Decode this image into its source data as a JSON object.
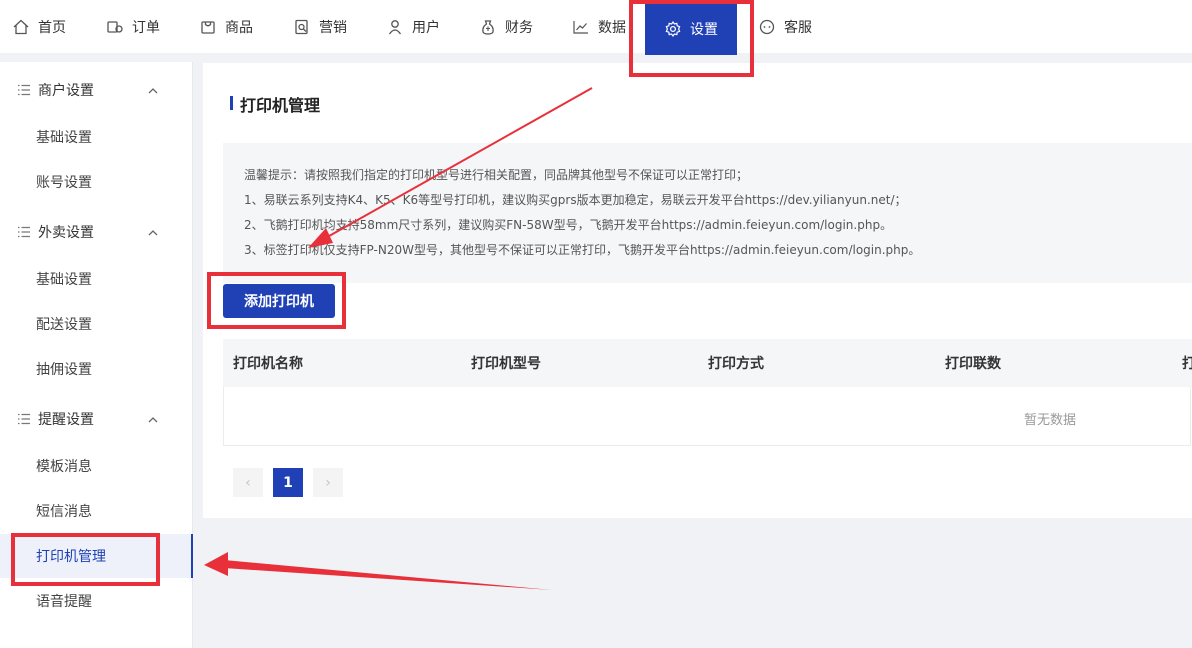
{
  "nav": {
    "items": [
      {
        "label": "首页",
        "icon": "home-icon"
      },
      {
        "label": "订单",
        "icon": "order-icon"
      },
      {
        "label": "商品",
        "icon": "goods-icon"
      },
      {
        "label": "营销",
        "icon": "marketing-icon"
      },
      {
        "label": "用户",
        "icon": "user-icon"
      },
      {
        "label": "财务",
        "icon": "finance-icon"
      },
      {
        "label": "数据",
        "icon": "chart-line-icon"
      },
      {
        "label": "设置",
        "icon": "gear-icon",
        "active": true
      },
      {
        "label": "客服",
        "icon": "service-chat-icon"
      }
    ]
  },
  "sidebar": {
    "groups": [
      {
        "label": "商户设置",
        "items": [
          "基础设置",
          "账号设置"
        ]
      },
      {
        "label": "外卖设置",
        "items": [
          "基础设置",
          "配送设置",
          "抽佣设置"
        ]
      },
      {
        "label": "提醒设置",
        "items": [
          "模板消息",
          "短信消息",
          "打印机管理",
          "语音提醒"
        ]
      }
    ],
    "active_item": "打印机管理"
  },
  "page": {
    "title": "打印机管理",
    "tips": [
      "温馨提示：请按照我们指定的打印机型号进行相关配置，同品牌其他型号不保证可以正常打印；",
      "1、易联云系列支持K4、K5、K6等型号打印机，建议购买gprs版本更加稳定，易联云开发平台https://dev.yilianyun.net/；",
      "2、飞鹅打印机均支持58mm尺寸系列，建议购买FN-58W型号，飞鹅开发平台https://admin.feieyun.com/login.php。",
      "3、标签打印机仅支持FP-N20W型号，其他型号不保证可以正常打印，飞鹅开发平台https://admin.feieyun.com/login.php。"
    ],
    "add_button": "添加打印机",
    "table": {
      "columns": [
        "打印机名称",
        "打印机型号",
        "打印方式",
        "打印联数",
        "打"
      ],
      "empty_text": "暂无数据"
    },
    "pagination": {
      "prev": "‹",
      "current": "1",
      "next": "›"
    }
  },
  "colors": {
    "accent": "#1f41b5",
    "highlight": "#e8303a"
  }
}
